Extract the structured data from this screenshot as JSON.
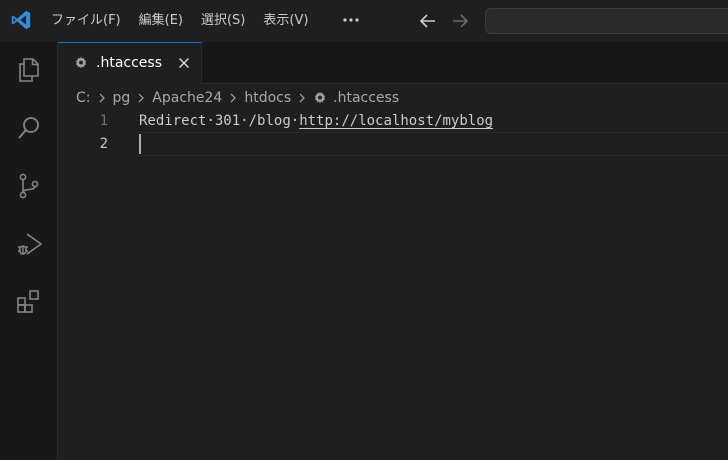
{
  "titlebar": {
    "menu": [
      "ファイル(F)",
      "編集(E)",
      "選択(S)",
      "表示(V)"
    ],
    "more_icon": "ellipsis-icon",
    "back_icon": "arrow-left-icon",
    "forward_icon": "arrow-right-icon"
  },
  "activitybar": {
    "items": [
      "explorer-icon",
      "search-icon",
      "source-control-icon",
      "run-debug-icon",
      "extensions-icon"
    ]
  },
  "tab": {
    "label": ".htaccess",
    "icon": "gear-icon",
    "close_icon": "close-icon"
  },
  "breadcrumb": {
    "items": [
      "C:",
      "pg",
      "Apache24",
      "htdocs",
      ".htaccess"
    ]
  },
  "editor": {
    "lines": [
      {
        "number": "1",
        "parts": [
          "Redirect",
          "301",
          "/blog"
        ],
        "link": "http://localhost/myblog"
      },
      {
        "number": "2",
        "parts": [],
        "link": ""
      }
    ]
  },
  "colors": {
    "background": "#1f1f1f",
    "activitybar": "#181818",
    "accent": "#0078d4",
    "text": "#cccccc"
  }
}
